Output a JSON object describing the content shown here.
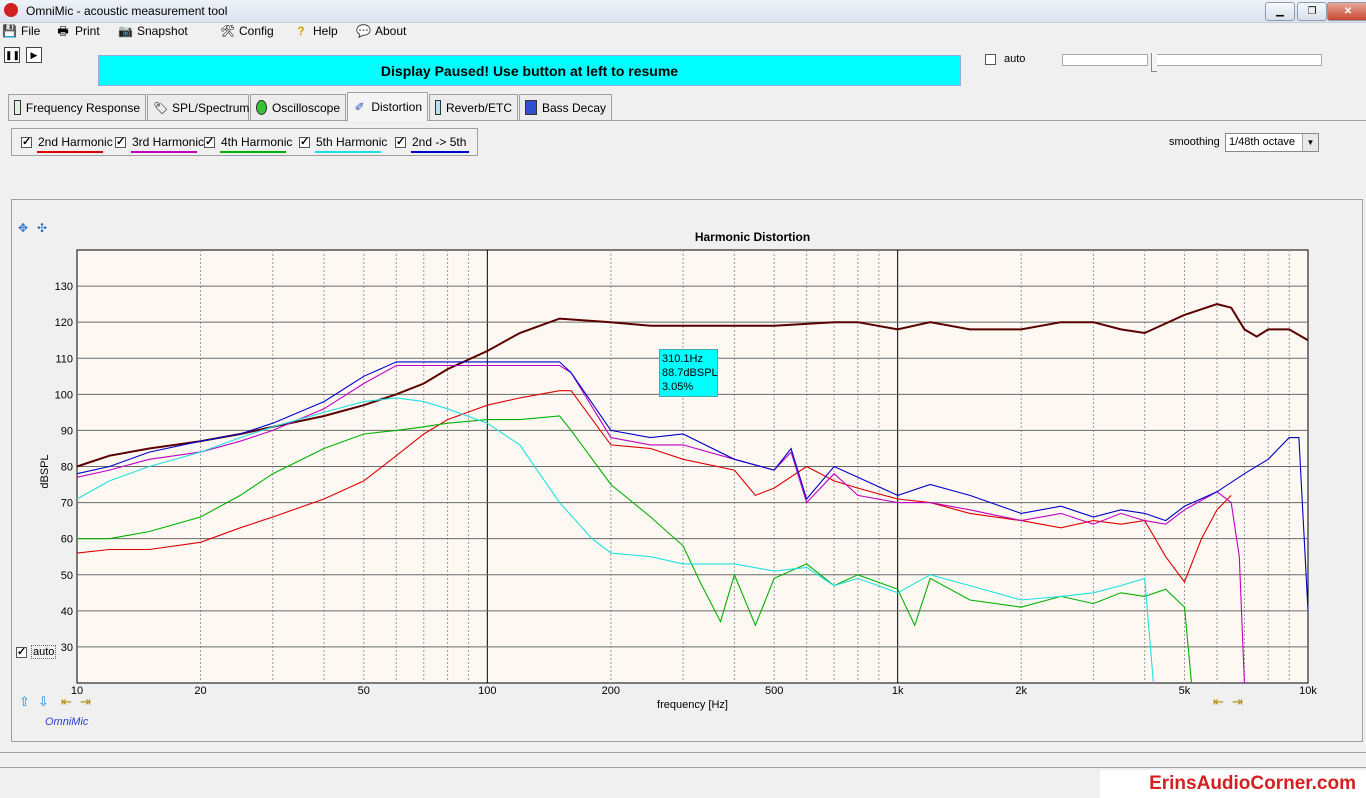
{
  "window": {
    "title": "OmniMic - acoustic measurement tool"
  },
  "menu": [
    {
      "label": "File",
      "icon": "floppy-icon"
    },
    {
      "label": "Print",
      "icon": "printer-icon"
    },
    {
      "label": "Snapshot",
      "icon": "camera-icon"
    },
    {
      "label": "Config",
      "icon": "tools-icon"
    },
    {
      "label": "Help",
      "icon": "help-icon"
    },
    {
      "label": "About",
      "icon": "speech-icon"
    }
  ],
  "banner": "Display Paused! Use button at left to resume",
  "top_auto_label": "auto",
  "tabs": [
    {
      "label": "Frequency Response"
    },
    {
      "label": "SPL/Spectrum"
    },
    {
      "label": "Oscilloscope"
    },
    {
      "label": "Distortion"
    },
    {
      "label": "Reverb/ETC"
    },
    {
      "label": "Bass Decay"
    }
  ],
  "harmonics": [
    {
      "label": "2nd Harmonic",
      "color": "#dd0000",
      "checked": true
    },
    {
      "label": "3rd Harmonic",
      "color": "#c000c0",
      "checked": true
    },
    {
      "label": "4th Harmonic",
      "color": "#00b000",
      "checked": true
    },
    {
      "label": "5th Harmonic",
      "color": "#20e0e0",
      "checked": true
    },
    {
      "label": "2nd -> 5th",
      "color": "#0000cc",
      "checked": true
    }
  ],
  "smoothing": {
    "label": "smoothing",
    "value": "1/48th octave"
  },
  "chart_auto_label": "auto",
  "brand": "OmniMic",
  "watermark": "ErinsAudioCorner.com",
  "tooltip": {
    "line1": "310.1Hz",
    "line2": "88.7dBSPL",
    "line3": "3.05%"
  },
  "chart_data": {
    "type": "line",
    "title": "Harmonic Distortion",
    "xlabel": "frequency [Hz]",
    "ylabel": "dBSPL",
    "x_scale": "log",
    "xlim": [
      10,
      10000
    ],
    "ylim": [
      20,
      140
    ],
    "x_ticks": [
      10,
      20,
      50,
      100,
      200,
      500,
      1000,
      2000,
      5000,
      10000
    ],
    "x_tick_labels": [
      "10",
      "20",
      "50",
      "100",
      "200",
      "500",
      "1k",
      "2k",
      "5k",
      "10k"
    ],
    "y_ticks": [
      30,
      40,
      50,
      60,
      70,
      80,
      90,
      100,
      110,
      120,
      130
    ],
    "grid": true,
    "series": [
      {
        "name": "",
        "color": "#5a0000",
        "x": [
          10,
          12,
          15,
          20,
          25,
          30,
          40,
          50,
          60,
          70,
          80,
          100,
          120,
          150,
          200,
          250,
          300,
          400,
          500,
          700,
          800,
          1000,
          1200,
          1500,
          2000,
          2500,
          3000,
          3500,
          4000,
          5000,
          6000,
          6500,
          7000,
          7500,
          8000,
          9000,
          10000
        ],
        "y": [
          80,
          83,
          85,
          87,
          89,
          91,
          94,
          97,
          100,
          103,
          107,
          112,
          117,
          121,
          120,
          119,
          119,
          119,
          119,
          120,
          120,
          118,
          120,
          118,
          118,
          120,
          120,
          118,
          117,
          122,
          125,
          124,
          118,
          116,
          118,
          118,
          115
        ]
      },
      {
        "name": "2nd Harmonic",
        "color": "#dd0000",
        "x": [
          10,
          12,
          15,
          20,
          25,
          30,
          40,
          50,
          60,
          70,
          80,
          100,
          120,
          150,
          160,
          200,
          250,
          300,
          400,
          450,
          500,
          600,
          700,
          800,
          1000,
          1200,
          1500,
          2000,
          2500,
          3000,
          3500,
          4000,
          4500,
          5000,
          5500,
          6000,
          6500
        ],
        "y": [
          56,
          57,
          57,
          59,
          63,
          66,
          71,
          76,
          83,
          89,
          93,
          97,
          99,
          101,
          101,
          86,
          85,
          82,
          79,
          72,
          74,
          80,
          76,
          74,
          71,
          70,
          67,
          65,
          63,
          65,
          64,
          65,
          55,
          48,
          60,
          68,
          72
        ]
      },
      {
        "name": "3rd Harmonic",
        "color": "#c000c0",
        "x": [
          10,
          12,
          15,
          20,
          25,
          30,
          40,
          50,
          60,
          70,
          80,
          100,
          120,
          150,
          160,
          200,
          250,
          300,
          400,
          500,
          550,
          600,
          700,
          800,
          1000,
          1200,
          1500,
          2000,
          2500,
          3000,
          3500,
          4000,
          4500,
          5000,
          6000,
          6500,
          6800,
          7000
        ],
        "y": [
          77,
          79,
          82,
          84,
          87,
          90,
          96,
          103,
          108,
          108,
          108,
          108,
          108,
          108,
          106,
          88,
          86,
          86,
          82,
          79,
          84,
          70,
          78,
          72,
          70,
          70,
          68,
          65,
          67,
          64,
          67,
          65,
          64,
          68,
          73,
          70,
          55,
          20
        ]
      },
      {
        "name": "4th Harmonic",
        "color": "#00b000",
        "x": [
          10,
          12,
          15,
          20,
          25,
          30,
          40,
          50,
          60,
          70,
          80,
          100,
          120,
          150,
          160,
          200,
          250,
          300,
          330,
          370,
          400,
          450,
          500,
          600,
          700,
          800,
          1000,
          1100,
          1200,
          1500,
          2000,
          2500,
          3000,
          3500,
          4000,
          4500,
          5000,
          5200
        ],
        "y": [
          60,
          60,
          62,
          66,
          72,
          78,
          85,
          89,
          90,
          91,
          92,
          93,
          93,
          94,
          90,
          75,
          66,
          58,
          48,
          37,
          50,
          36,
          49,
          53,
          47,
          50,
          46,
          36,
          49,
          43,
          41,
          44,
          42,
          45,
          44,
          46,
          41,
          20
        ]
      },
      {
        "name": "5th Harmonic",
        "color": "#20e0e0",
        "x": [
          10,
          12,
          15,
          20,
          25,
          30,
          40,
          50,
          60,
          70,
          80,
          100,
          120,
          150,
          180,
          200,
          250,
          300,
          400,
          500,
          600,
          700,
          800,
          1000,
          1200,
          1500,
          2000,
          2500,
          3000,
          3500,
          4000,
          4200
        ],
        "y": [
          71,
          76,
          80,
          84,
          88,
          91,
          95,
          98,
          99,
          98,
          96,
          92,
          86,
          70,
          60,
          56,
          55,
          53,
          53,
          51,
          52,
          47,
          49,
          45,
          50,
          47,
          43,
          44,
          45,
          47,
          49,
          20
        ]
      },
      {
        "name": "2nd -> 5th",
        "color": "#0000cc",
        "x": [
          10,
          12,
          15,
          20,
          25,
          30,
          40,
          50,
          60,
          70,
          80,
          100,
          120,
          150,
          160,
          200,
          250,
          300,
          400,
          500,
          550,
          600,
          700,
          800,
          1000,
          1200,
          1500,
          2000,
          2500,
          3000,
          3500,
          4000,
          4500,
          5000,
          6000,
          7000,
          8000,
          9000,
          9500,
          10000
        ],
        "y": [
          78,
          80,
          84,
          87,
          89,
          92,
          98,
          105,
          109,
          109,
          109,
          109,
          109,
          109,
          106,
          90,
          88,
          89,
          82,
          79,
          85,
          71,
          80,
          77,
          72,
          75,
          72,
          67,
          69,
          66,
          68,
          67,
          65,
          69,
          73,
          78,
          82,
          88,
          88,
          40
        ]
      }
    ]
  }
}
